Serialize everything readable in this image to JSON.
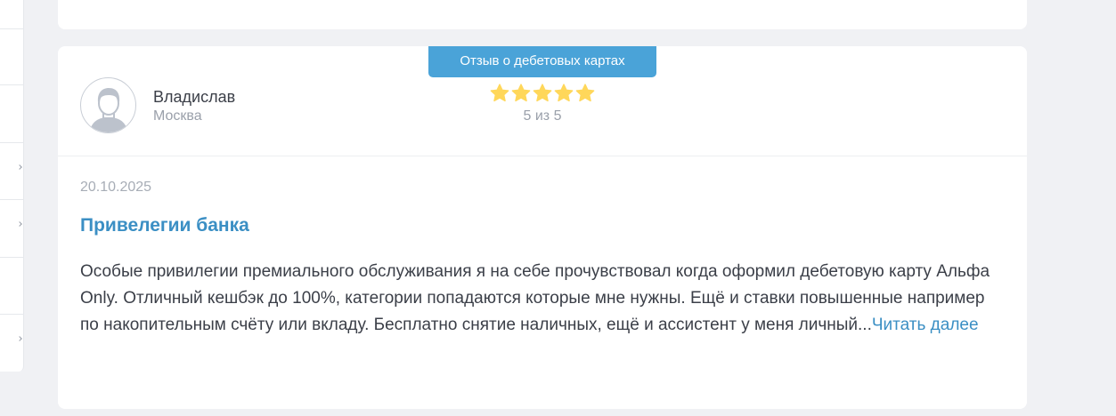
{
  "review": {
    "badge": "Отзыв о дебетовых картах",
    "author": {
      "name": "Владислав",
      "city": "Москва"
    },
    "rating": {
      "stars": 5,
      "max": 5,
      "text": "5 из 5"
    },
    "date": "20.10.2025",
    "title": "Привелегии банка",
    "body": "Особые привилегии премиального обслуживания я на себе прочувствовал когда оформил дебетовую карту Альфа Only. Отличный кешбэк до 100%, категории попадаются которые мне нужны. Ещё и ставки повышенные например по накопительным счёту или вкладу. Бесплатно снятие наличных, ещё и ассистент у меня личный...",
    "read_more": "Читать далее"
  },
  "colors": {
    "accent": "#4aa3d8",
    "link": "#3b8fc4",
    "star": "#ffd75a",
    "background": "#f0f1f4"
  },
  "icons": {
    "avatar": "user-avatar-icon",
    "star": "star-icon",
    "chevron": "chevron-right-icon"
  }
}
